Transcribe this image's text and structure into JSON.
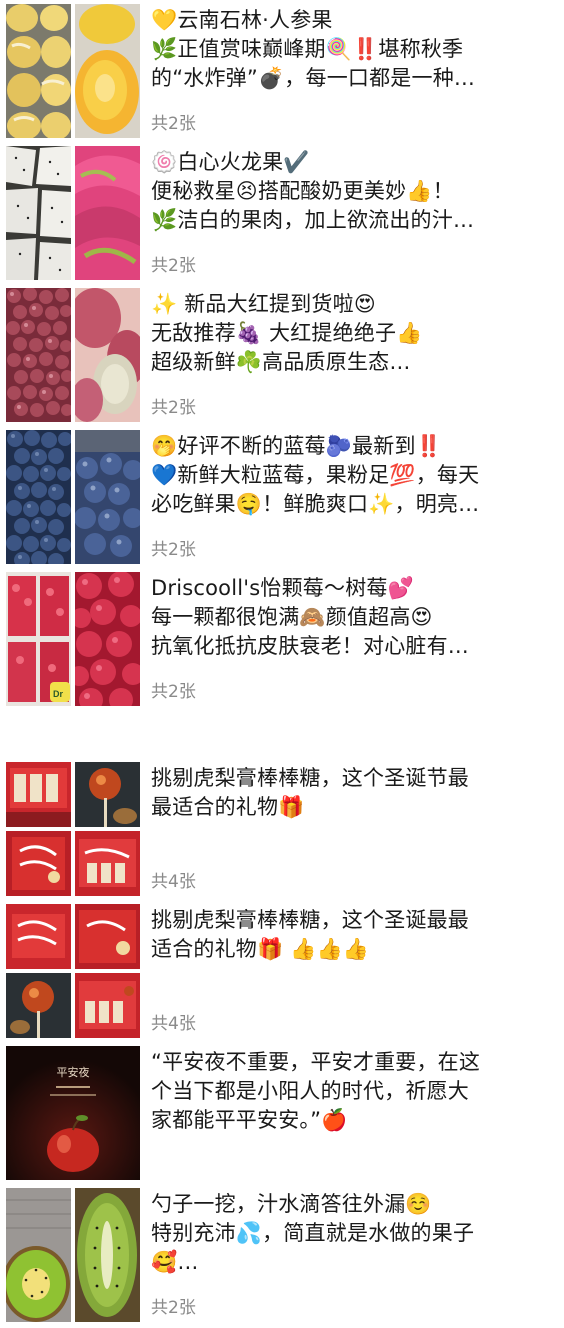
{
  "posts": [
    {
      "lines": [
        "💛云南石林·人参果",
        "🌿正值赏味巅峰期🍭‼️堪称秋季",
        "的“水炸弹”💣，每一口都是一种…"
      ],
      "count": "共2张"
    },
    {
      "lines": [
        "🍥白心火龙果✔️",
        "便秘救星😣搭配酸奶更美妙👍！",
        "🌿洁白的果肉，加上欲流出的汁…"
      ],
      "count": "共2张"
    },
    {
      "lines": [
        "✨ 新品大红提到货啦😍",
        "无敌推荐🍇 大红提绝绝子👍",
        "超级新鲜☘️高品质原生态…"
      ],
      "count": "共2张"
    },
    {
      "lines": [
        "🤭好评不断的蓝莓🫐最新到‼️",
        "💙新鲜大粒蓝莓，果粉足💯，每天",
        "必吃鲜果🤤！鲜脆爽口✨，明亮…"
      ],
      "count": "共2张"
    },
    {
      "lines": [
        "Driscooll's怡颗莓～树莓💕",
        "每一颗都很饱满🙈颜值超高😍",
        "抗氧化抵抗皮肤衰老！对心脏有…"
      ],
      "count": "共2张"
    },
    {
      "lines": [
        "挑剔虎梨膏棒棒糖，这个圣诞节最",
        "最适合的礼物🎁"
      ],
      "count": "共4张"
    },
    {
      "lines": [
        "挑剔虎梨膏棒棒糖，这个圣诞最最",
        "适合的礼物🎁 👍👍👍"
      ],
      "count": "共4张"
    },
    {
      "lines": [
        "“平安夜不重要，平安才重要，在这",
        "个当下都是小阳人的时代，祈愿大",
        "家都能平平安安。”🍎"
      ],
      "count": ""
    },
    {
      "lines": [
        "勺子一挖，汁水滴答往外漏☺️",
        "特别充沛💦，简直就是水做的果子",
        "🥰…"
      ],
      "count": "共2张"
    }
  ],
  "thumb_labels": {
    "gift_box": "Driscoll's",
    "ping_an_title": "平安夜"
  },
  "colors": {
    "count_text": "#8a8a8a",
    "body_text": "#1a1a1a"
  }
}
